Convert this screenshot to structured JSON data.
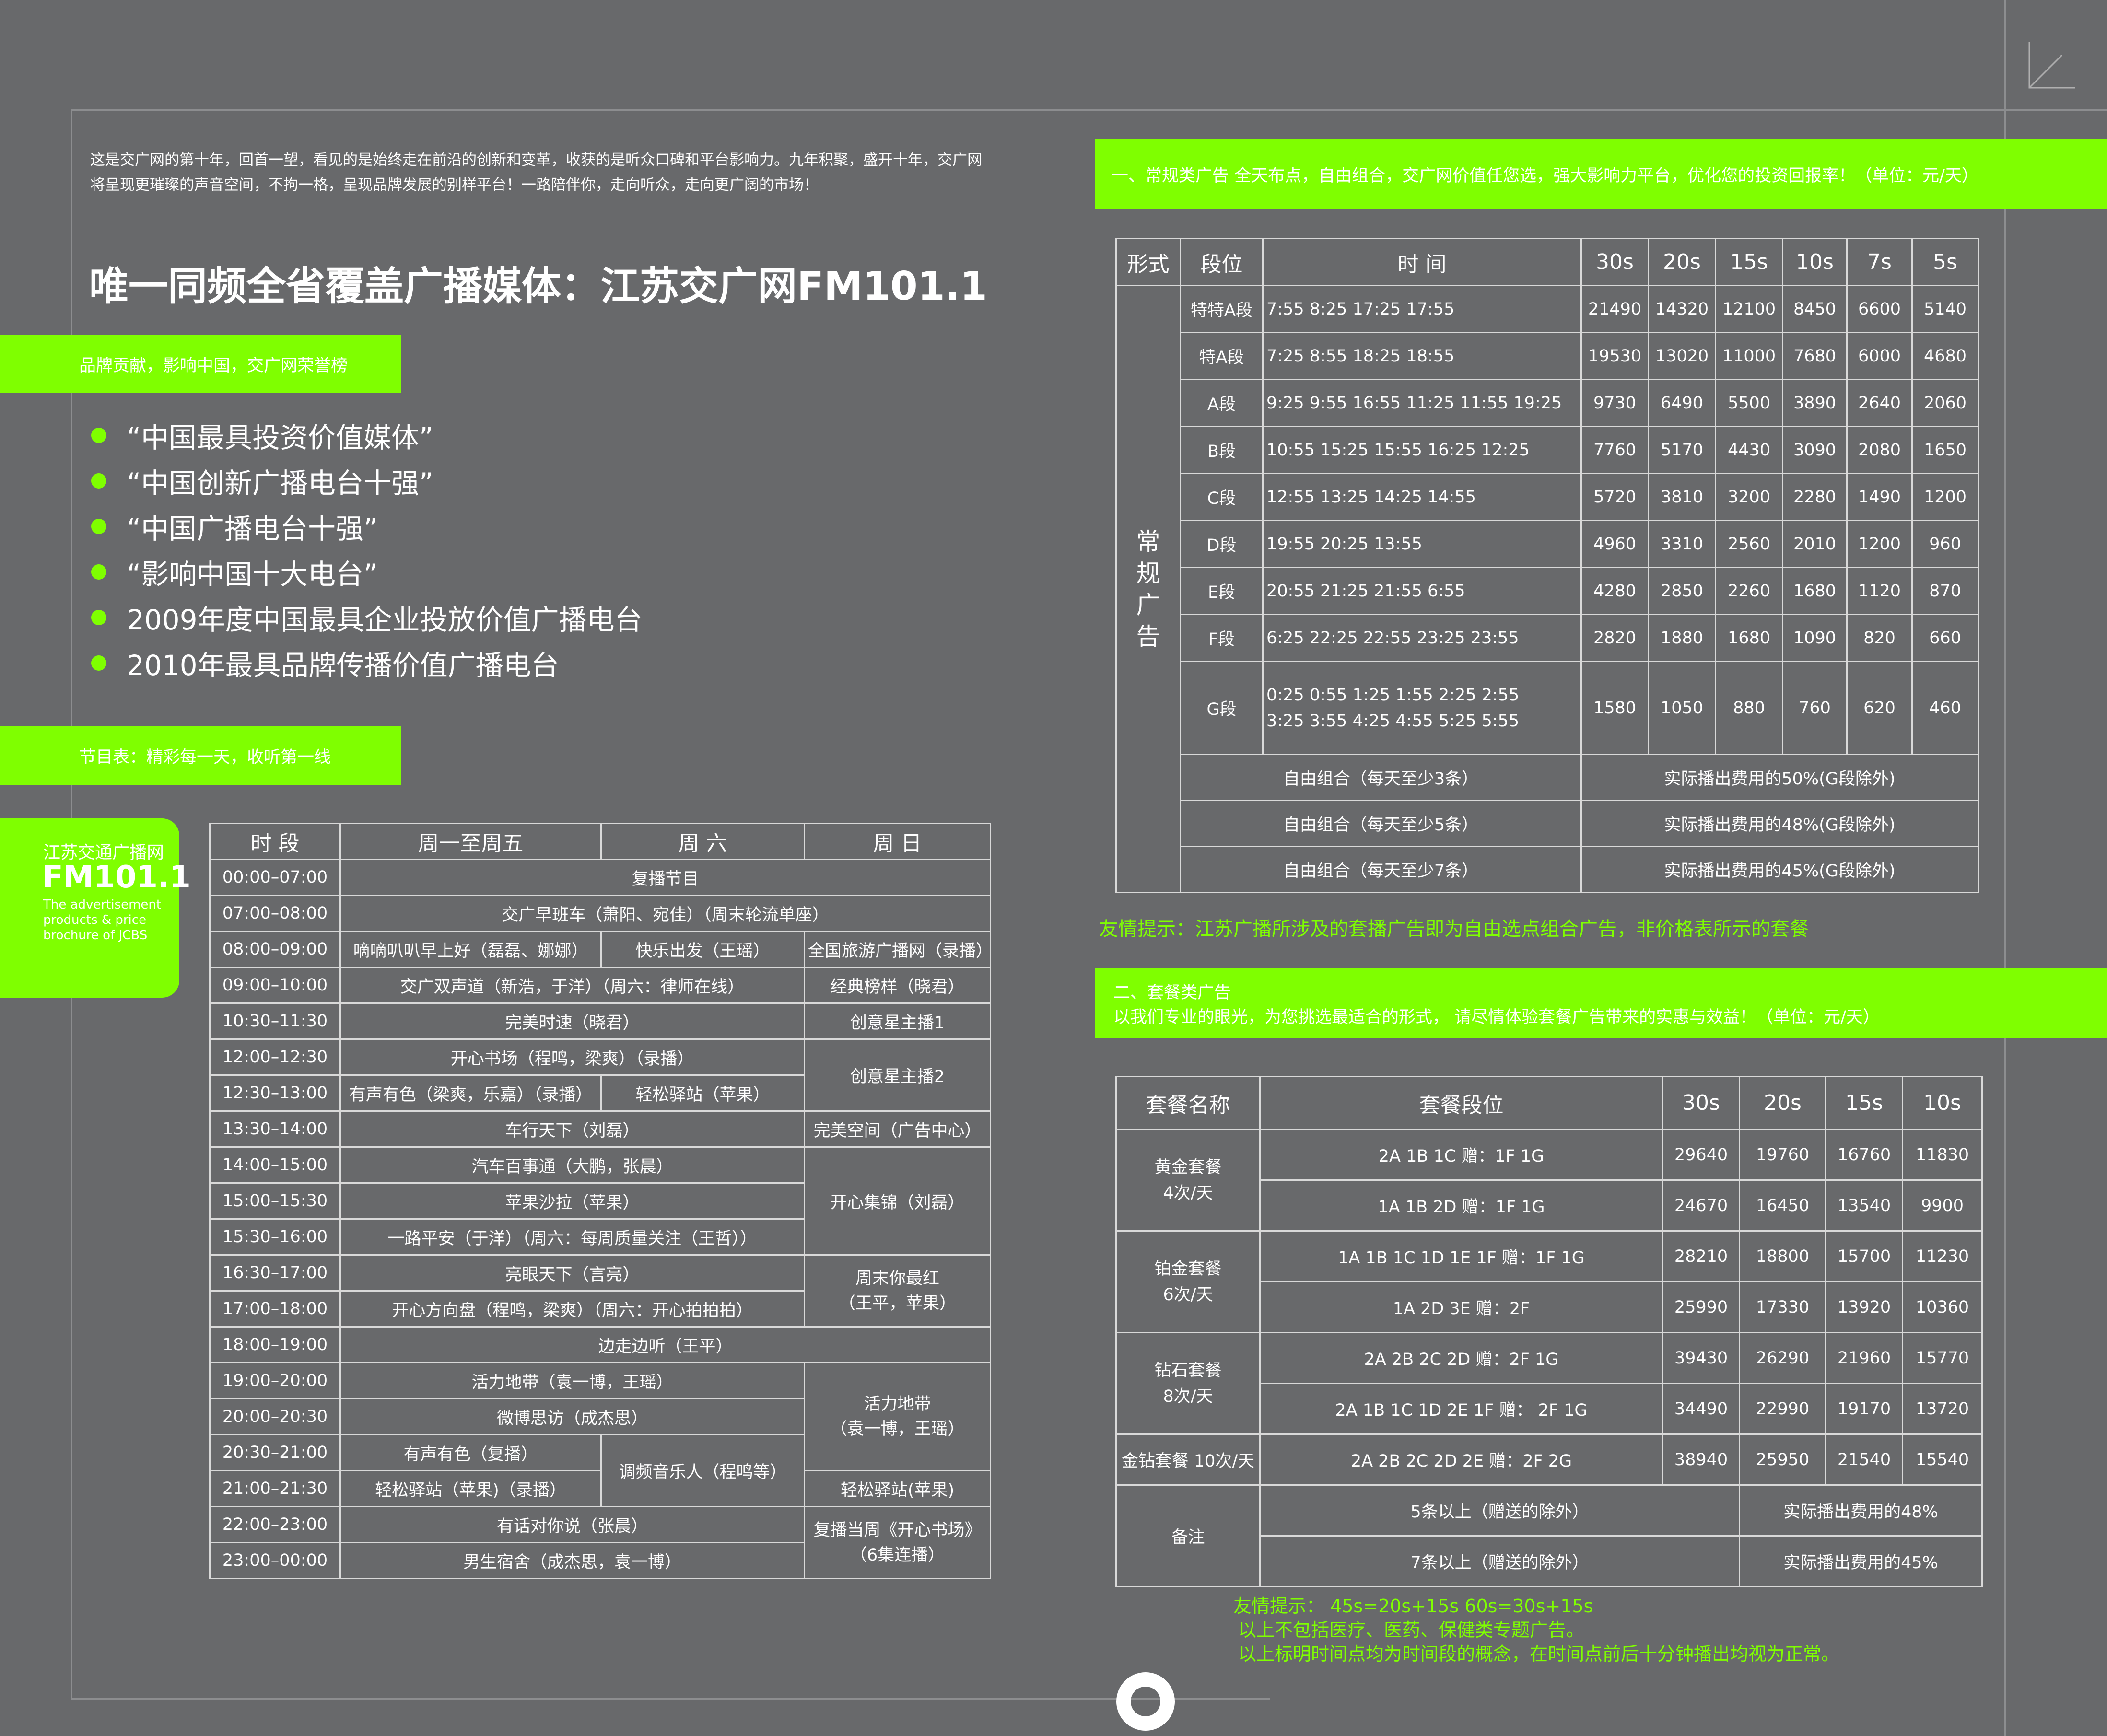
{
  "intro": "这是交广网的第十年，回首一望，看见的是始终走在前沿的创新和变革，收获的是听众口碑和平台影响力。九年积聚，盛开十年，交广网将呈现更璀璨的声音空间，不拘一格，呈现品牌发展的别样平台！一路陪伴你，走向听众，走向更广阔的市场！",
  "headline": "唯一同频全省覆盖广播媒体：江苏交广网FM101.1",
  "brand_bar": "品牌贡献，影响中国，交广网荣誉榜",
  "honors": [
    "“中国最具投资价值媒体”",
    "“中国创新广播电台十强”",
    "“中国广播电台十强”",
    "“影响中国十大电台”",
    " 2009年度中国最具企业投放价值广播电台",
    " 2010年最具品牌传播价值广播电台"
  ],
  "schedule_bar": "节目表：精彩每一天，收听第一线",
  "brand_box": {
    "line1": "江苏交通广播网",
    "line2": "FM101.1",
    "line3": "The advertisement products & price brochure of JCBS"
  },
  "schedule": {
    "headers": [
      "时 段",
      "周一至周五",
      "周 六",
      "周 日"
    ],
    "r1": [
      "00:00–07:00",
      "复播节目"
    ],
    "r2": [
      "07:00–08:00",
      "交广早班车（萧阳、宛佳）（周末轮流单座）"
    ],
    "r3": [
      "08:00–09:00",
      "嘀嘀叭叭早上好（磊磊、娜娜）",
      "快乐出发（王瑶）",
      "全国旅游广播网（录播）"
    ],
    "r4": [
      "09:00–10:00",
      "交广双声道（新浩，于洋）（周六：律师在线）",
      "经典榜样（晓君）"
    ],
    "r5": [
      "10:30–11:30",
      "完美时速（晓君）",
      "创意星主播1"
    ],
    "r6": [
      "12:00–12:30",
      "开心书场（程鸣，梁爽）（录播）",
      "创意星主播2"
    ],
    "r7": [
      "12:30–13:00",
      "有声有色（梁爽，乐嘉）（录播）",
      "轻松驿站（苹果）"
    ],
    "r8": [
      "13:30–14:00",
      "车行天下（刘磊）",
      "完美空间（广告中心）"
    ],
    "r9": [
      "14:00–15:00",
      "汽车百事通（大鹏，张晨）",
      "开心集锦（刘磊）"
    ],
    "r10": [
      "15:00–15:30",
      "苹果沙拉（苹果）"
    ],
    "r11": [
      "15:30–16:00",
      "一路平安（于洋）（周六：每周质量关注（王哲））"
    ],
    "r12": [
      "16:30–17:00",
      "亮眼天下（言亮）",
      "周末你最红",
      "（王平，苹果）"
    ],
    "r13": [
      "17:00–18:00",
      "开心方向盘（程鸣，梁爽）（周六：开心拍拍拍）"
    ],
    "r14": [
      "18:00–19:00",
      "边走边听（王平）"
    ],
    "r15": [
      "19:00–20:00",
      "活力地带（袁一博，王瑶）",
      "活力地带",
      "（袁一博，王瑶）"
    ],
    "r16": [
      "20:00–20:30",
      "微博思访（成杰思）"
    ],
    "r17": [
      "20:30–21:00",
      "有声有色（复播）",
      "调频音乐人（程鸣等）"
    ],
    "r18": [
      "21:00–21:30",
      "轻松驿站（苹果)（录播）",
      "轻松驿站(苹果)"
    ],
    "r19": [
      "22:00–23:00",
      "有话对你说（张晨）",
      "复播当周《开心书场》",
      "（6集连播）"
    ],
    "r20": [
      "23:00–00:00",
      "男生宿舍（成杰思，袁一博）"
    ]
  },
  "regular_bar": "一、常规类广告  全天布点，自由组合，交广网价值任您选，强大影响力平台，优化您的投资回报率！（单位：元/天）",
  "rates": {
    "headers": [
      "形式",
      "段位",
      "时    间",
      "30s",
      "20s",
      "15s",
      "10s",
      "7s",
      "5s"
    ],
    "category": "常规广告",
    "rows": [
      [
        "特特A段",
        "7:55   8:25   17:25  17:55",
        "21490",
        "14320",
        "12100",
        "8450",
        "6600",
        "5140"
      ],
      [
        "特A段",
        "7:25    8:55    18:25    18:55",
        "19530",
        "13020",
        "11000",
        "7680",
        "6000",
        "4680"
      ],
      [
        "A段",
        "9:25  9:55  16:55  11:25  11:55  19:25",
        "9730",
        "6490",
        "5500",
        "3890",
        "2640",
        "2060"
      ],
      [
        "B段",
        "10:55  15:25  15:55  16:25   12:25",
        "7760",
        "5170",
        "4430",
        "3090",
        "2080",
        "1650"
      ],
      [
        "C段",
        "12:55  13:25  14:25   14:55",
        "5720",
        "3810",
        "3200",
        "2280",
        "1490",
        "1200"
      ],
      [
        "D段",
        "19:55    20:25    13:55",
        "4960",
        "3310",
        "2560",
        "2010",
        "1200",
        "960"
      ],
      [
        "E段",
        "20:55   21:25    21:55   6:55",
        "4280",
        "2850",
        "2260",
        "1680",
        "1120",
        "870"
      ],
      [
        "F段",
        "6:25   22:25    22:55   23:25  23:55",
        "2820",
        "1880",
        "1680",
        "1090",
        "820",
        "660"
      ]
    ],
    "g_row": {
      "name": "G段",
      "time1": "0:25    0:55    1:25    1:55    2:25    2:55",
      "time2": "3:25    3:55    4:25    4:55    5:25    5:55",
      "values": [
        "1580",
        "1050",
        "880",
        "760",
        "620",
        "460"
      ]
    },
    "combos": [
      [
        "自由组合（每天至少3条）",
        "实际播出费用的50%(G段除外)"
      ],
      [
        "自由组合（每天至少5条）",
        "实际播出费用的48%(G段除外)"
      ],
      [
        "自由组合（每天至少7条）",
        "实际播出费用的45%(G段除外)"
      ]
    ]
  },
  "tip1": "友情提示：江苏广播所涉及的套播广告即为自由选点组合广告，非价格表所示的套餐",
  "package_bar": {
    "line1": "二、套餐类广告",
    "line2": "以我们专业的眼光，为您挑选最适合的形式， 请尽情体验套餐广告带来的实惠与效益！（单位：元/天）"
  },
  "packages": {
    "headers": [
      "套餐名称",
      "套餐段位",
      "30s",
      "20s",
      "15s",
      "10s"
    ],
    "gold": {
      "name": "黄金套餐",
      "freq": "4次/天",
      "rows": [
        [
          "2A    1B    1C     赠：1F  1G",
          "29640",
          "19760",
          "16760",
          "11830"
        ],
        [
          "1A    1B   2D     赠：1F  1G",
          "24670",
          "16450",
          "13540",
          "9900"
        ]
      ]
    },
    "platinum": {
      "name": "铂金套餐",
      "freq": "6次/天",
      "rows": [
        [
          "1A  1B  1C  1D  1E   1F    赠：1F  1G",
          "28210",
          "18800",
          "15700",
          "11230"
        ],
        [
          "1A  2D  3E    赠：2F",
          "25990",
          "17330",
          "13920",
          "10360"
        ]
      ]
    },
    "diamond": {
      "name": "钻石套餐",
      "freq": "8次/天",
      "rows": [
        [
          "2A    2B    2C    2D      赠：2F  1G",
          "39430",
          "26290",
          "21960",
          "15770"
        ],
        [
          "2A  1B  1C  1D  2E  1F  赠：  2F  1G",
          "34490",
          "22990",
          "19170",
          "13720"
        ]
      ]
    },
    "gold_diamond": {
      "name": "金钻套餐 10次/天",
      "row": [
        "2A   2B   2C   2D  2E   赠：2F  2G",
        "38940",
        "25950",
        "21540",
        "15540"
      ]
    },
    "note": {
      "label": "备注",
      "rows": [
        [
          "5条以上（赠送的除外）",
          "实际播出费用的48%"
        ],
        [
          "7条以上（赠送的除外）",
          "实际播出费用的45%"
        ]
      ]
    }
  },
  "tip2": {
    "line1": "友情提示：  45s=20s+15s   60s=30s+15s",
    "line2": "以上不包括医疗、医药、保健类专题广告。",
    "line3": "以上标明时间点均为时间段的概念，在时间点前后十分钟播出均视为正常。"
  },
  "colors": {
    "background": "#68696b",
    "accent": "#7fff00",
    "text": "#ffffff"
  }
}
